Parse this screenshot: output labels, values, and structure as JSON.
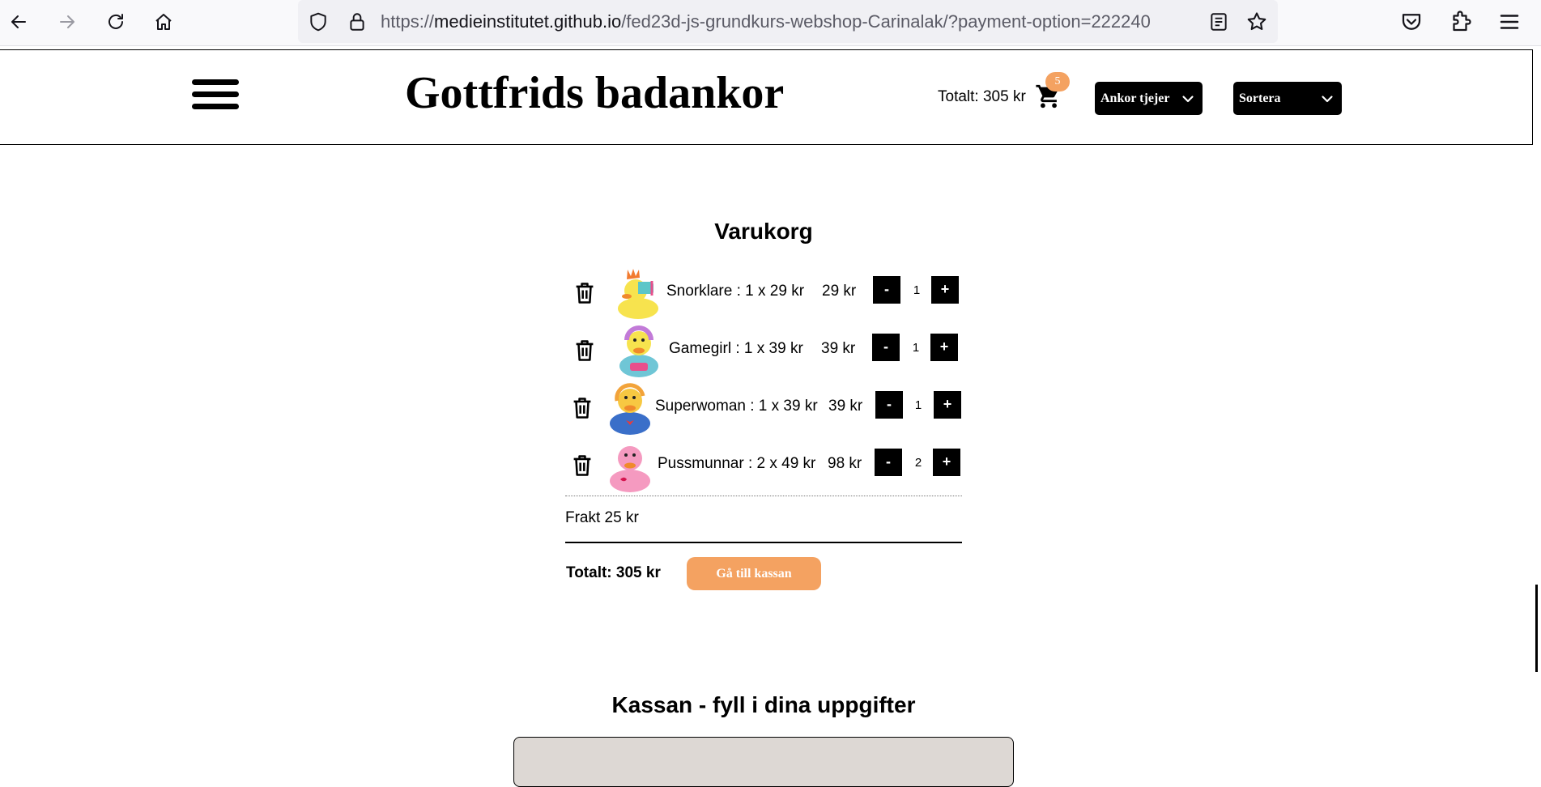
{
  "browser": {
    "url_prefix": "https://",
    "url_domain": "medieinstitutet.github.io",
    "url_path": "/fed23d-js-grundkurs-webshop-Carinalak/?payment-option=222240",
    "icons": [
      "back-arrow-icon",
      "forward-arrow-icon",
      "reload-icon",
      "home-icon",
      "shield-icon",
      "lock-icon",
      "reader-view-icon",
      "bookmark-star-icon",
      "pocket-icon",
      "extensions-icon",
      "menu-icon"
    ]
  },
  "header": {
    "title": "Gottfrids badankor",
    "total_text": "Totalt: 305 kr",
    "cart_count": "5",
    "filter_label": "Ankor tjejer",
    "sort_label": "Sortera"
  },
  "cart": {
    "heading": "Varukorg",
    "items": [
      {
        "name": "Snorklare",
        "label": "Snorklare : 1 x 29 kr",
        "price": "29 kr",
        "qty": "1",
        "minus": "-",
        "plus": "+"
      },
      {
        "name": "Gamegirl",
        "label": "Gamegirl : 1 x 39 kr",
        "price": "39 kr",
        "qty": "1",
        "minus": "-",
        "plus": "+"
      },
      {
        "name": "Superwoman",
        "label": "Superwoman : 1 x 39 kr",
        "price": "39 kr",
        "qty": "1",
        "minus": "-",
        "plus": "+"
      },
      {
        "name": "Pussmunnar",
        "label": "Pussmunnar : 2 x 49 kr",
        "price": "98 kr",
        "qty": "2",
        "minus": "-",
        "plus": "+"
      }
    ],
    "shipping": "Frakt 25 kr",
    "total": "Totalt: 305 kr",
    "checkout_button": "Gå till kassan"
  },
  "checkout": {
    "heading": "Kassan - fyll i dina uppgifter"
  },
  "colors": {
    "accent": "#f4a261",
    "form_background": "#ddd8d4"
  }
}
